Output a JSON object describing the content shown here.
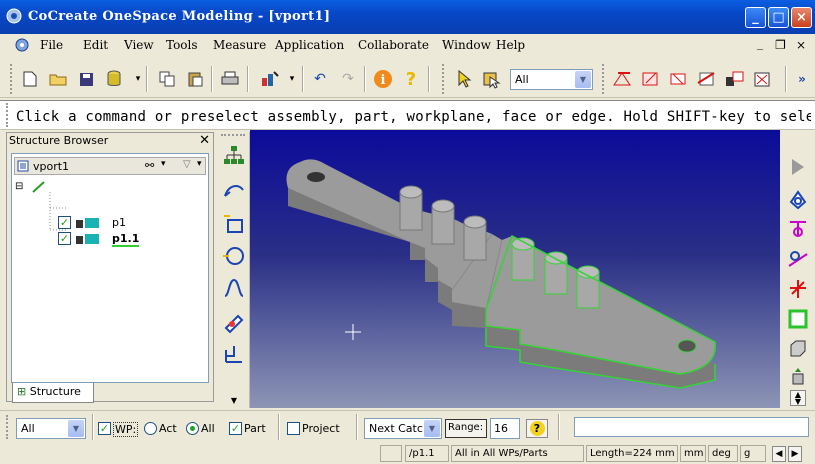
{
  "window": {
    "title": "CoCreate OneSpace Modeling - [vport1]",
    "minimize": "_",
    "maximize": "□",
    "close": "×"
  },
  "menu": [
    "File",
    "Edit",
    "View",
    "Tools",
    "Measure",
    "Application",
    "Collaborate",
    "Window",
    "Help"
  ],
  "menu_controls": {
    "minimize": "_",
    "restore": "❐",
    "close": "×"
  },
  "toolbar": {
    "filter_value": "All"
  },
  "prompt": "Click a command or preselect assembly, part, workplane, face or edge. Hold SHIFT-key to select mult",
  "structure_browser": {
    "header": "Structure Browser",
    "root": "vport1",
    "items": [
      {
        "label": "p1"
      },
      {
        "label": "p1.1"
      }
    ],
    "tab": "Structure"
  },
  "select_bar": {
    "filter": "All",
    "wp_label": "WP:",
    "act_label": "Act",
    "all_label": "All",
    "part_label": "Part",
    "project_label": "Project",
    "catch_value": "Next Catc",
    "range_label": "Range:",
    "range_value": "16",
    "help": "?"
  },
  "status": {
    "current": "/p1.1",
    "scope": "All in All WPs/Parts",
    "length": "Length=224 mm",
    "unit_len": "mm",
    "unit_ang": "deg",
    "unit_mass": "g"
  },
  "colors": {
    "title_bar": "#0747c7",
    "viewport_top": "#0b0b9a",
    "highlight": "#35d435"
  }
}
